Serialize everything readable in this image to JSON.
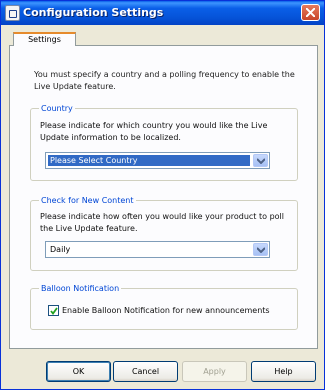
{
  "window": {
    "title": "Configuration Settings"
  },
  "tabs": [
    {
      "label": "Settings"
    }
  ],
  "intro": "You must specify a country and a polling frequency to enable the Live Update feature.",
  "country": {
    "title": "Country",
    "description": "Please indicate for which country you would like the Live Update information to be localized.",
    "selected": "Please Select Country"
  },
  "content": {
    "title": "Check for New Content",
    "description": "Please indicate how often you would like your product to poll the Live Update feature.",
    "selected": "Daily"
  },
  "balloon": {
    "title": "Balloon Notification",
    "checkbox_label": "Enable Balloon Notification for new announcements",
    "checked": true
  },
  "buttons": {
    "ok": "OK",
    "cancel": "Cancel",
    "apply": "Apply",
    "help": "Help"
  },
  "colors": {
    "titlebar": "#0a5fe8",
    "group_title": "#0046d5",
    "selection": "#316ac5"
  }
}
